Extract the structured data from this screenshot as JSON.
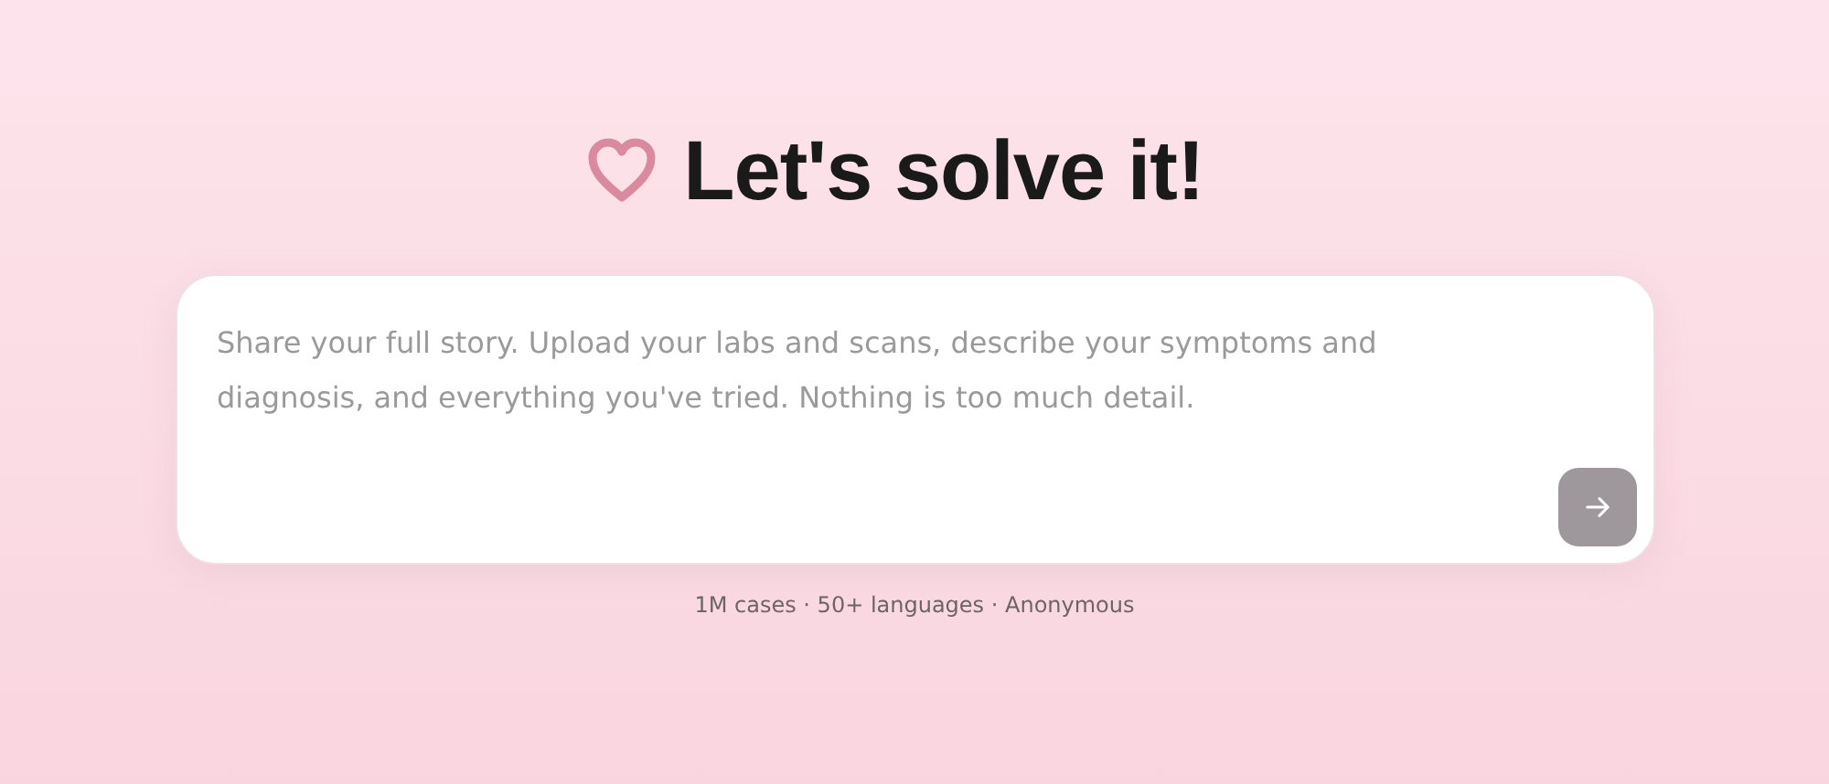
{
  "heading": {
    "title": "Let's solve it!"
  },
  "story_field": {
    "placeholder": "Share your full story. Upload your labs and scans, describe your symptoms and diagnosis, and everything you've tried. Nothing is too much detail."
  },
  "send_button": {
    "disabled": true
  },
  "footer": "1M cases · 50+ languages · Anonymous"
}
